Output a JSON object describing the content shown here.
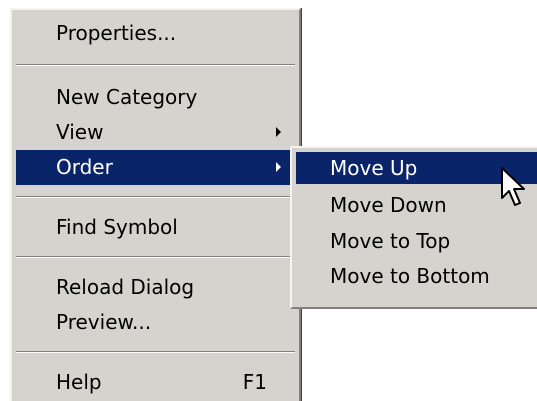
{
  "context_menu": {
    "items": [
      {
        "label": "Properties...",
        "submenu": false,
        "shortcut": ""
      },
      {
        "label": "New Category",
        "submenu": false,
        "shortcut": ""
      },
      {
        "label": "View",
        "submenu": true,
        "shortcut": ""
      },
      {
        "label": "Order",
        "submenu": true,
        "shortcut": "",
        "highlighted": true
      },
      {
        "label": "Find Symbol",
        "submenu": false,
        "shortcut": ""
      },
      {
        "label": "Reload Dialog",
        "submenu": false,
        "shortcut": ""
      },
      {
        "label": "Preview...",
        "submenu": false,
        "shortcut": ""
      },
      {
        "label": "Help",
        "submenu": false,
        "shortcut": "F1"
      }
    ]
  },
  "order_submenu": {
    "items": [
      {
        "label": "Move Up",
        "highlighted": true
      },
      {
        "label": "Move Down"
      },
      {
        "label": "Move to Top"
      },
      {
        "label": "Move to Bottom"
      }
    ]
  },
  "colors": {
    "menu_background": "#d6d3ce",
    "highlight": "#0a246a",
    "highlight_text": "#ffffff"
  },
  "icons": {
    "submenu_arrow": "chevron-right-icon",
    "cursor": "mouse-pointer-icon"
  }
}
